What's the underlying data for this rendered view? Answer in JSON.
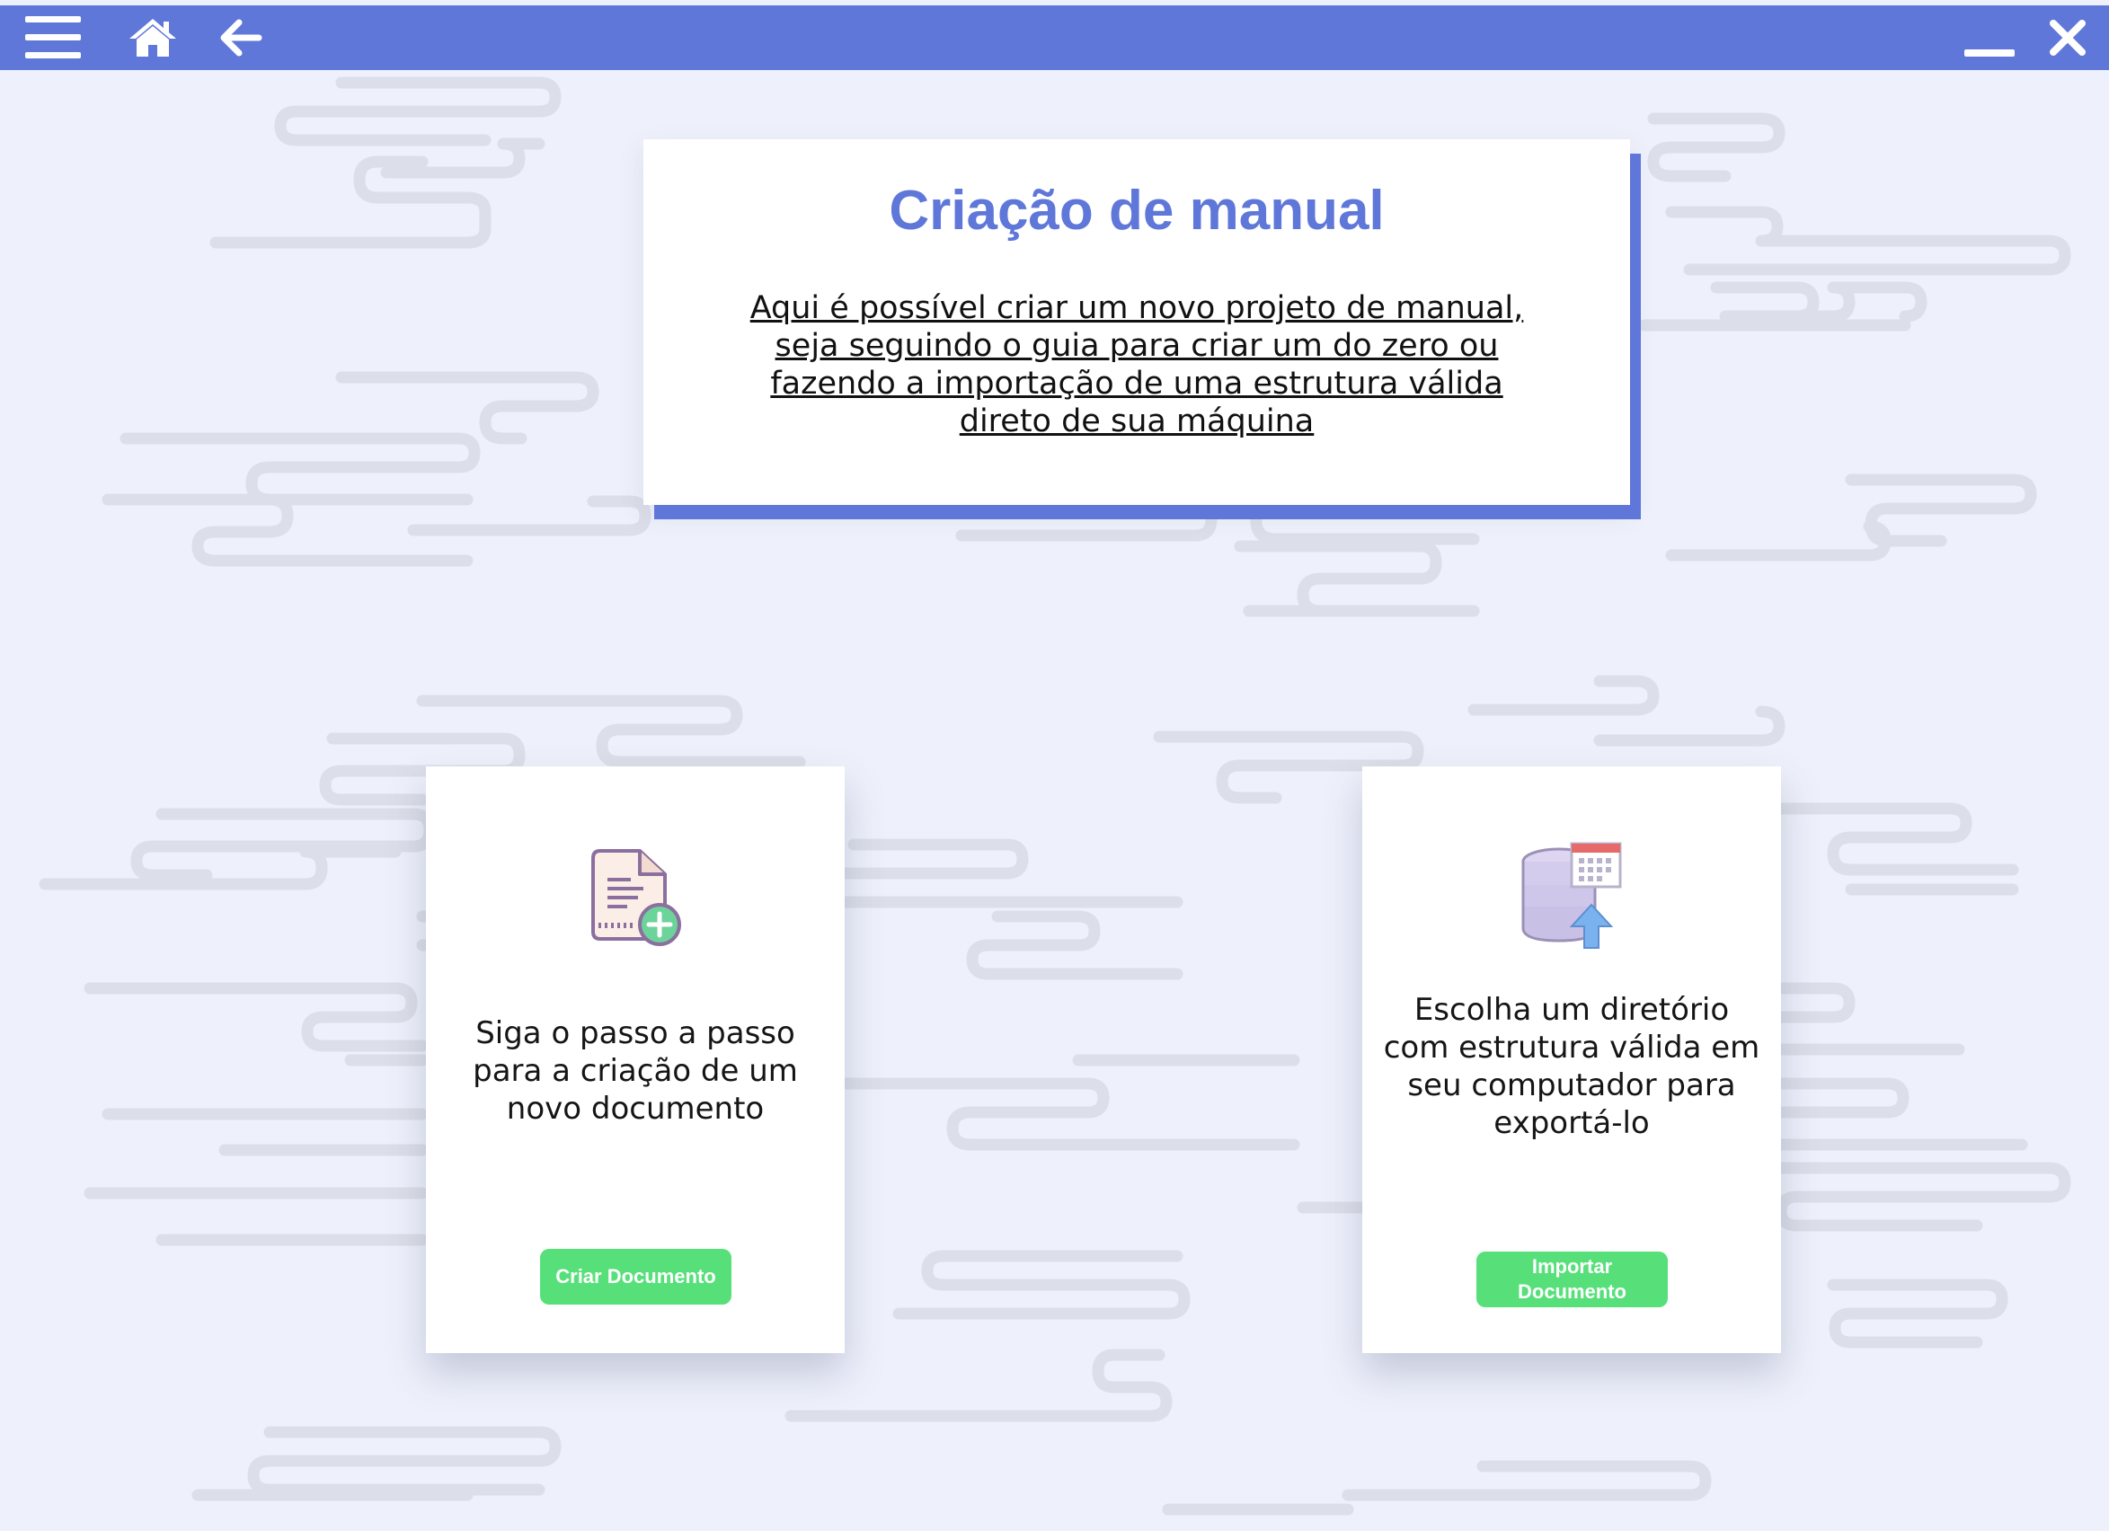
{
  "window": {
    "title": "",
    "menu_icon": "hamburger-icon",
    "home_icon": "home-icon",
    "back_icon": "arrow-left-icon",
    "minimize_icon": "minimize-icon",
    "close_icon": "close-icon"
  },
  "colors": {
    "accent": "#5e77d9",
    "background": "#eef1fb",
    "button": "#57e07a",
    "pattern": "#dcdfe9"
  },
  "info": {
    "title": "Criação de manual",
    "description": "Aqui é possível criar um novo projeto de manual, seja seguindo o guia para criar um do zero ou fazendo a importação de uma estrutura válida direto de sua máquina"
  },
  "cards": {
    "create": {
      "icon": "new-document-icon",
      "text": "Siga o passo a passo para a criação de um novo documento",
      "button_label": "Criar Documento"
    },
    "import": {
      "icon": "database-upload-icon",
      "text": "Escolha um diretório com estrutura válida em seu computador para exportá-lo",
      "button_label": "Importar Documento"
    }
  }
}
